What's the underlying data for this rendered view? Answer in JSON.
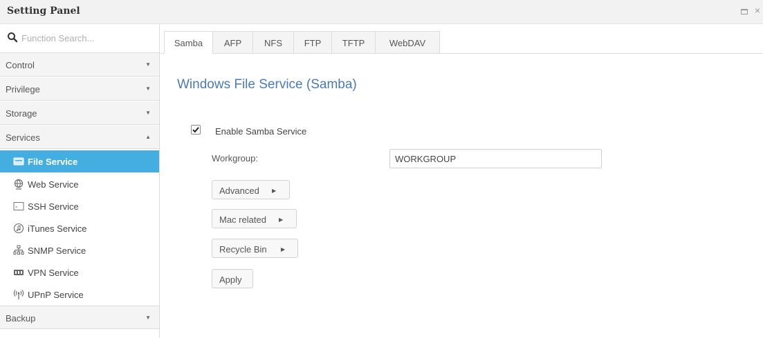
{
  "window": {
    "title": "Setting Panel",
    "maximize_icon": "maximize-icon",
    "close_glyph": "×"
  },
  "sidebar": {
    "search": {
      "placeholder": "Function Search...",
      "value": "",
      "icon": "search-icon"
    },
    "groups": [
      {
        "label": "Control",
        "state": "collapsed"
      },
      {
        "label": "Privilege",
        "state": "collapsed"
      },
      {
        "label": "Storage",
        "state": "collapsed"
      },
      {
        "label": "Services",
        "state": "expanded"
      },
      {
        "label": "Backup",
        "state": "collapsed"
      }
    ],
    "items": [
      {
        "label": "File Service",
        "icon": "file-service-icon",
        "active": true
      },
      {
        "label": "Web Service",
        "icon": "globe-icon"
      },
      {
        "label": "SSH Service",
        "icon": "terminal-icon"
      },
      {
        "label": "iTunes Service",
        "icon": "music-note-icon"
      },
      {
        "label": "SNMP Service",
        "icon": "network-tree-icon"
      },
      {
        "label": "VPN Service",
        "icon": "vpn-icon"
      },
      {
        "label": "UPnP Service",
        "icon": "antenna-icon"
      }
    ]
  },
  "tabs": [
    {
      "label": "Samba",
      "active": true
    },
    {
      "label": "AFP"
    },
    {
      "label": "NFS"
    },
    {
      "label": "FTP"
    },
    {
      "label": "TFTP"
    },
    {
      "label": "WebDAV"
    }
  ],
  "main": {
    "heading": "Windows File Service (Samba)",
    "enable_label": "Enable Samba Service",
    "enable_checked": true,
    "workgroup_label": "Workgroup:",
    "workgroup_value": "WORKGROUP",
    "buttons": {
      "advanced": "Advanced",
      "mac_related": "Mac related",
      "recycle_bin": "Recycle Bin",
      "apply": "Apply"
    }
  },
  "colors": {
    "accent": "#45aee0",
    "heading": "#4a7ab3"
  }
}
